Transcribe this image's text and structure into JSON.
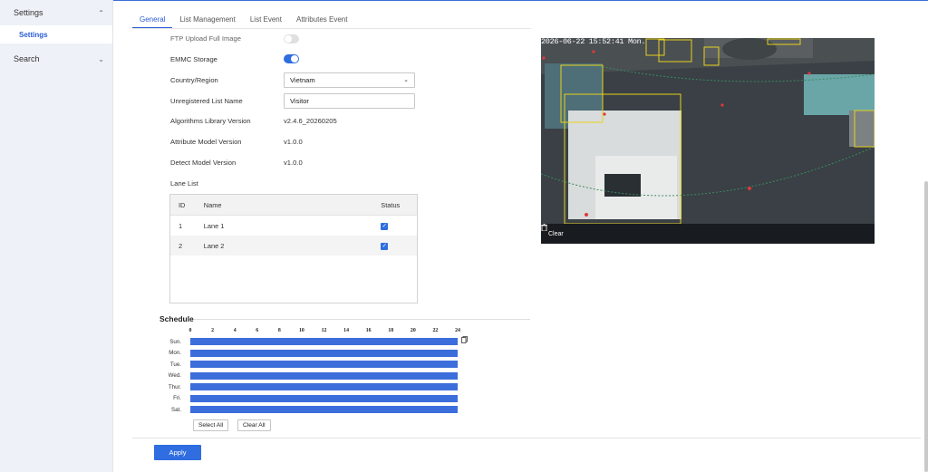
{
  "sidebar": {
    "groups": [
      {
        "label": "Settings",
        "expanded": true,
        "items": [
          {
            "label": "Settings",
            "active": true
          }
        ]
      },
      {
        "label": "Search",
        "expanded": false,
        "items": []
      }
    ]
  },
  "tabs": [
    {
      "label": "General",
      "active": true
    },
    {
      "label": "List Management",
      "active": false
    },
    {
      "label": "List Event",
      "active": false
    },
    {
      "label": "Attributes Event",
      "active": false
    }
  ],
  "form": {
    "ftp_label": "FTP Upload Full Image",
    "ftp_enabled": false,
    "emmc_label": "EMMC Storage",
    "emmc_enabled": true,
    "country_label": "Country/Region",
    "country_value": "Vietnam",
    "unregistered_label": "Unregistered List Name",
    "unregistered_value": "Visitor",
    "algo_label": "Algorithms Library Version",
    "algo_value": "v2.4.6_20260205",
    "attr_label": "Attribute Model Version",
    "attr_value": "v1.0.0",
    "detect_label": "Detect Model Version",
    "detect_value": "v1.0.0"
  },
  "lane": {
    "title": "Lane List",
    "headers": {
      "id": "ID",
      "name": "Name",
      "status": "Status"
    },
    "rows": [
      {
        "id": "1",
        "name": "Lane 1",
        "checked": true
      },
      {
        "id": "2",
        "name": "Lane 2",
        "checked": true
      }
    ]
  },
  "schedule": {
    "title": "Schedule",
    "hours": [
      "0",
      "2",
      "4",
      "6",
      "8",
      "10",
      "12",
      "14",
      "16",
      "18",
      "20",
      "22",
      "24"
    ],
    "days": [
      "Sun.",
      "Mon.",
      "Tue.",
      "Wed.",
      "Thur.",
      "Fri.",
      "Sat."
    ],
    "select_all": "Select All",
    "clear_all": "Clear All"
  },
  "apply_label": "Apply",
  "video": {
    "timestamp": "2026-06-22 15:52:41 Mon.",
    "clear_label": "Clear"
  },
  "colors": {
    "accent": "#2f6de0",
    "schedule_bar": "#3c6edb",
    "detection_box": "#e6d21a",
    "video_bar": "#181b1f"
  }
}
